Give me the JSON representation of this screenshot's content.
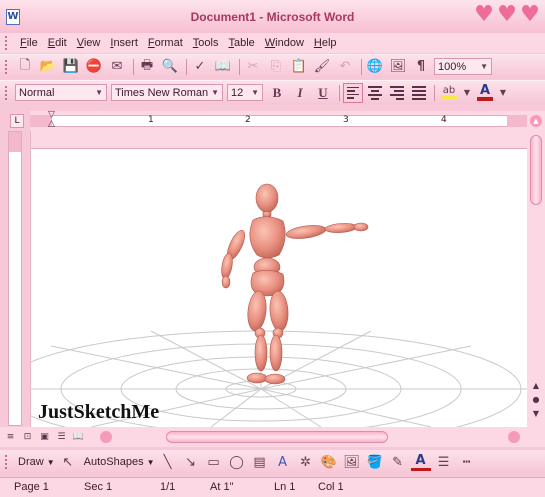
{
  "window": {
    "title": "Document1 - Microsoft Word",
    "app_icon_letter": "W"
  },
  "menubar": {
    "items": [
      "File",
      "Edit",
      "View",
      "Insert",
      "Format",
      "Tools",
      "Table",
      "Window",
      "Help"
    ]
  },
  "standard_toolbar": {
    "icons": [
      "new-doc-icon",
      "open-icon",
      "save-icon",
      "permission-icon",
      "email-icon",
      "print-icon",
      "print-preview-icon",
      "spelling-icon",
      "research-icon",
      "cut-icon",
      "copy-icon",
      "paste-icon",
      "format-painter-icon",
      "undo-icon",
      "hyperlink-icon",
      "drawing-toggle-icon",
      "show-hide-icon"
    ],
    "show_hide_glyph": "¶",
    "zoom": "100%"
  },
  "formatting_toolbar": {
    "style": "Normal",
    "font": "Times New Roman",
    "size": "12",
    "bold": "B",
    "italic": "I",
    "underline": "U"
  },
  "ruler": {
    "numbers": [
      "1",
      "2",
      "3",
      "4"
    ]
  },
  "document": {
    "watermark": "JustSketchMe"
  },
  "draw_toolbar": {
    "draw_label": "Draw",
    "autoshapes_label": "AutoShapes"
  },
  "status": {
    "page": "Page 1",
    "sec": "Sec 1",
    "pages": "1/1",
    "at": "At 1\"",
    "ln": "Ln 1",
    "col": "Col 1"
  },
  "colors": {
    "theme_pink": "#f7c9d8",
    "highlight": "#f7e84a",
    "font_color": "#c01818",
    "figure": "#e88f80"
  }
}
